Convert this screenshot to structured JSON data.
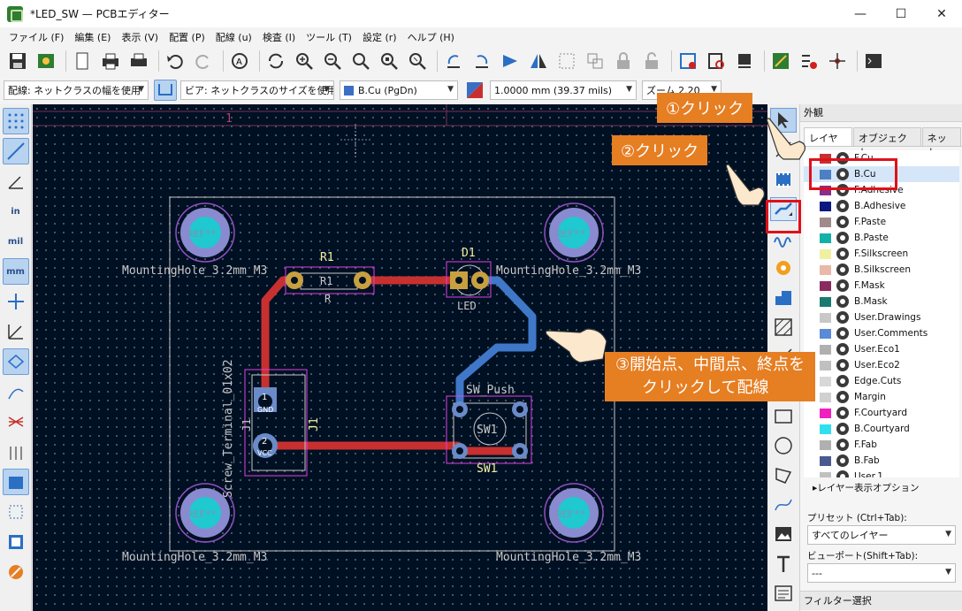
{
  "window": {
    "title": "*LED_SW — PCBエディター",
    "minimize": "—",
    "maximize": "☐",
    "close": "✕"
  },
  "menu": [
    "ファイル (F)",
    "編集 (E)",
    "表示 (V)",
    "配置 (P)",
    "配線 (u)",
    "検査 (I)",
    "ツール (T)",
    "設定 (r)",
    "ヘルプ (H)"
  ],
  "subbar": {
    "track_width": "配線: ネットクラスの幅を使用",
    "via_size": "ビア: ネットクラスのサイズを使用",
    "layer": "B.Cu (PgDn)",
    "grid": "1.0000 mm (39.37 mils)",
    "zoom": "ズーム 2.20",
    "layer_color": "#3a6fc4"
  },
  "left_tools": [
    "grid-dots",
    "grid-lines",
    "polar",
    "in",
    "mil",
    "mm",
    "cursor",
    "ratsnest",
    "rule",
    "net",
    "lines",
    "zones",
    "pad",
    "edge",
    "via",
    "pin"
  ],
  "canvas": {
    "sheet_marker": "1",
    "refs": {
      "r1": "R1",
      "r1_body": "R1",
      "r1_val": "R",
      "d1": "D1",
      "d1_val": "LED",
      "sw1_title": "SW_Push",
      "sw1_body": "SW1",
      "sw1_ref": "SW1",
      "j1_ref": "J1",
      "j1_ref2": "J1",
      "j1_val": "Screw_Terminal_01x02",
      "j1_pad1": "1",
      "j1_pad1_net": "GND",
      "j1_pad2": "2",
      "j1_pad2_net": "VCC",
      "mh_tl": "MountingHole_3.2mm_M3",
      "mh_tr": "MountingHole_3.2mm_M3",
      "mh_bl": "MountingHole_3.2mm_M3",
      "mh_br": "MountingHole_3.2mm_M3",
      "mh_ref": "REF**"
    },
    "colors": {
      "front_track": "#c83030",
      "back_track": "#3f78c8",
      "edge": "#c8c8c8",
      "courtyard": "#e040e0",
      "pad_hole": "#20c8d0"
    }
  },
  "annotations": {
    "step1": "①クリック",
    "step2": "②クリック",
    "step3_line1": "③開始点、中間点、終点を",
    "step3_line2": "クリックして配線",
    "callout_color": "#e67e22",
    "highlight_color": "#e0101a"
  },
  "panel": {
    "title": "外観",
    "tabs": [
      "レイヤー",
      "オブジェクト",
      "ネット"
    ],
    "layers": [
      {
        "name": "F.Cu",
        "color": "#c83030"
      },
      {
        "name": "B.Cu",
        "color": "#4d7fc4"
      },
      {
        "name": "F.Adhesive",
        "color": "#8a2c8a"
      },
      {
        "name": "B.Adhesive",
        "color": "#0a1a80"
      },
      {
        "name": "F.Paste",
        "color": "#a08a8a"
      },
      {
        "name": "B.Paste",
        "color": "#12b0a8"
      },
      {
        "name": "F.Silkscreen",
        "color": "#f0f0a0"
      },
      {
        "name": "B.Silkscreen",
        "color": "#e8b8a8"
      },
      {
        "name": "F.Mask",
        "color": "#8a2a60"
      },
      {
        "name": "B.Mask",
        "color": "#1a7a70"
      },
      {
        "name": "User.Drawings",
        "color": "#c8c8c8"
      },
      {
        "name": "User.Comments",
        "color": "#5a8ad8"
      },
      {
        "name": "User.Eco1",
        "color": "#b0b0b0"
      },
      {
        "name": "User.Eco2",
        "color": "#c0c0c0"
      },
      {
        "name": "Edge.Cuts",
        "color": "#d8d8d8"
      },
      {
        "name": "Margin",
        "color": "#d0d0d0"
      },
      {
        "name": "F.Courtyard",
        "color": "#f020c0"
      },
      {
        "name": "B.Courtyard",
        "color": "#30e0f0"
      },
      {
        "name": "F.Fab",
        "color": "#b0b0b0"
      },
      {
        "name": "B.Fab",
        "color": "#4a5a90"
      },
      {
        "name": "User.1",
        "color": "#c0c0c0"
      }
    ],
    "display_options": "▸レイヤー表示オプション",
    "preset_label": "プリセット (Ctrl+Tab):",
    "preset_value": "すべてのレイヤー",
    "viewport_label": "ビューポート(Shift+Tab):",
    "viewport_value": "---",
    "filter_title": "フィルター選択"
  }
}
